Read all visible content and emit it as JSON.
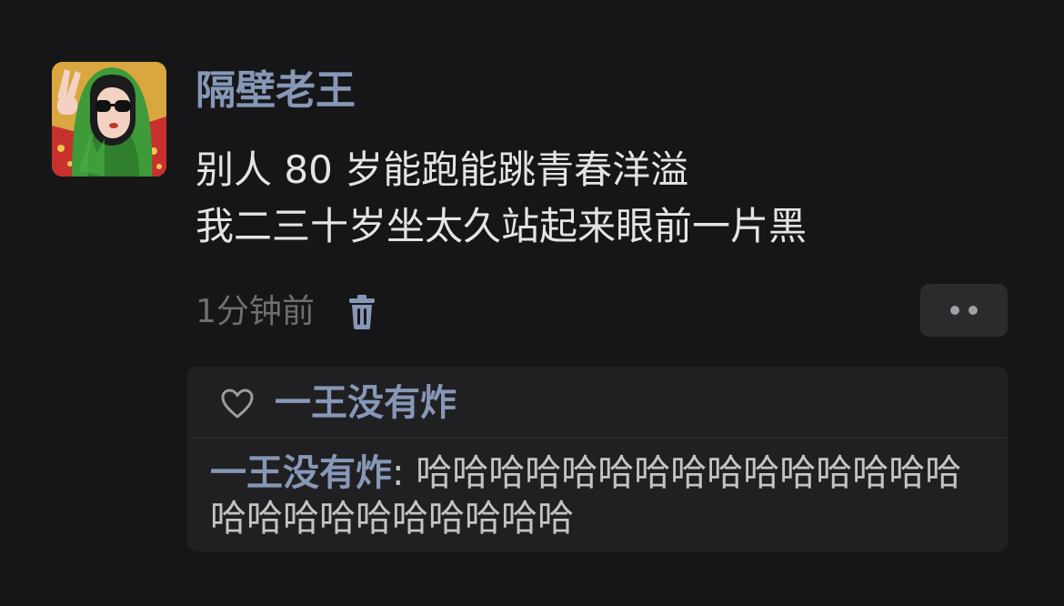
{
  "post": {
    "avatar_icon": "user-avatar-illustration",
    "username": "隔壁老王",
    "text_lines": [
      "别人 80 岁能跑能跳青春洋溢",
      "我二三十岁坐太久站起来眼前一片黑"
    ],
    "timestamp": "1分钟前",
    "delete_icon": "trash-icon",
    "more_icon": "more-dots-icon"
  },
  "reply_box": {
    "like_icon": "heart-icon",
    "liked_by": "一王没有炸",
    "reply": {
      "author": "一王没有炸",
      "separator": ": ",
      "text": "哈哈哈哈哈哈哈哈哈哈哈哈哈哈哈哈哈哈哈哈哈哈哈哈哈"
    }
  },
  "colors": {
    "background": "#161618",
    "username": "#8797b6",
    "body_text": "#e4e4e6",
    "muted_text": "#6e6e72",
    "panel": "#202023",
    "button": "#2b2b2e"
  }
}
